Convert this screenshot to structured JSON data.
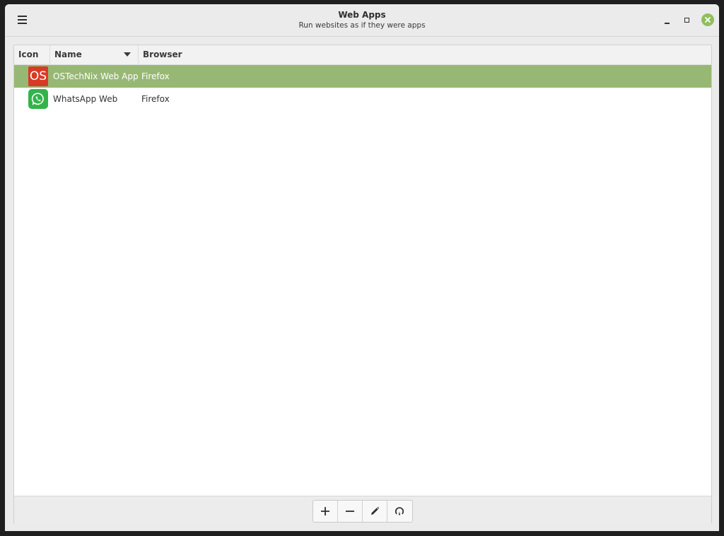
{
  "window": {
    "title": "Web Apps",
    "subtitle": "Run websites as if they were apps"
  },
  "columns": {
    "icon": "Icon",
    "name": "Name",
    "browser": "Browser"
  },
  "rows": [
    {
      "icon": "ostechnix-icon",
      "icon_text": "OS",
      "name": "OSTechNix Web App",
      "browser": "Firefox",
      "selected": true
    },
    {
      "icon": "whatsapp-icon",
      "name": "WhatsApp Web",
      "browser": "Firefox",
      "selected": false
    }
  ],
  "toolbar": {
    "buttons": [
      "add-icon",
      "remove-icon",
      "edit-icon",
      "run-icon"
    ]
  },
  "colors": {
    "selection": "#97b874",
    "close_button": "#8fbf5f",
    "ostechnix_red": "#d93a26",
    "whatsapp_green": "#34b34a"
  }
}
